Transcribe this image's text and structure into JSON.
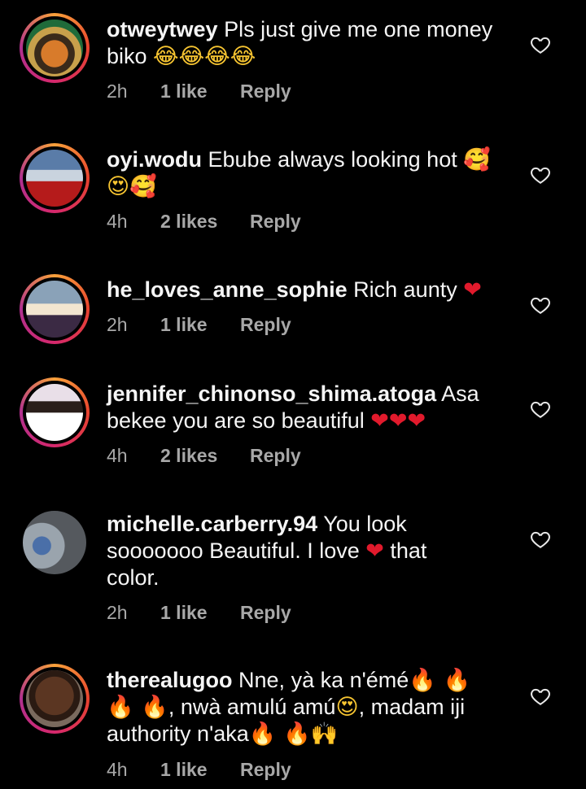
{
  "comments": [
    {
      "username": "otweytwey",
      "text": "Pls just give me one money biko",
      "emoji": "😂😂😂😂",
      "time": "2h",
      "likes": "1 like",
      "reply": "Reply",
      "avatar_ring": true
    },
    {
      "username": "oyi.wodu",
      "text": "Ebube always looking hot",
      "emoji": "🥰😍🥰",
      "time": "4h",
      "likes": "2 likes",
      "reply": "Reply",
      "avatar_ring": true
    },
    {
      "username": "he_loves_anne_sophie",
      "text": "Rich aunty",
      "emoji": "❤",
      "time": "2h",
      "likes": "1 like",
      "reply": "Reply",
      "avatar_ring": true
    },
    {
      "username": "jennifer_chinonso_shima.atoga",
      "text": "Asa bekee you are so beautiful",
      "emoji": "❤❤❤",
      "time": "4h",
      "likes": "2 likes",
      "reply": "Reply",
      "avatar_ring": true
    },
    {
      "username": "michelle.carberry.94",
      "text_before": "You look sooooooo Beautiful. I love",
      "emoji": "❤",
      "text_after": "that color.",
      "time": "2h",
      "likes": "1 like",
      "reply": "Reply",
      "avatar_ring": false
    },
    {
      "username": "therealugoo",
      "text_part1": "Nne, yà ka n'émé",
      "emoji1": "🔥 🔥 🔥 🔥",
      "text_part2": ", nwà amulú amú",
      "emoji2": "😍",
      "text_part3": ", madam iji authority n'aka",
      "emoji3": "🔥 🔥🙌",
      "time": "4h",
      "likes": "1 like",
      "reply": "Reply",
      "avatar_ring": true
    }
  ],
  "icons": {
    "like": "heart-outline-icon"
  },
  "colors": {
    "background": "#000000",
    "text": "#f5f5f5",
    "meta": "#a8a8a8",
    "ring_gradient": [
      "#f9a13a",
      "#e8432e",
      "#d6286c",
      "#b0308f"
    ]
  }
}
